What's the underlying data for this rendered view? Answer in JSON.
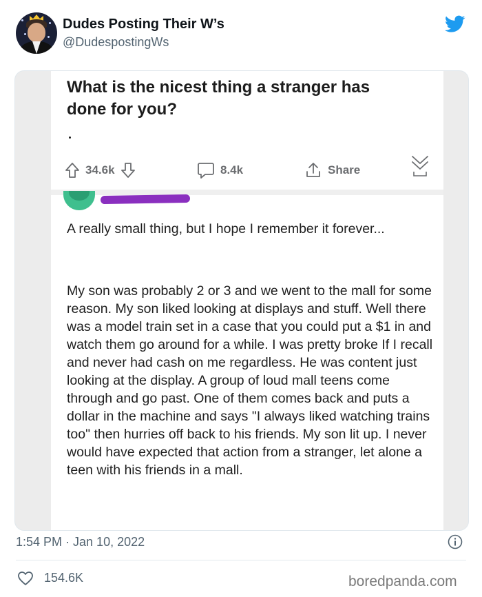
{
  "author": {
    "display_name": "Dudes Posting Their W’s",
    "handle": "@DudespostingWs"
  },
  "embedded_post": {
    "question": "What is the nicest thing a stranger has done for you?",
    "upvotes": "34.6k",
    "comments": "8.4k",
    "share_label": "Share",
    "lead": "A really small thing, but I hope I remember it forever...",
    "body": "My son was probably 2 or 3 and we went to the mall for some reason. My son liked looking at displays and stuff. Well there was a model train set in a case that you could put a $1 in and watch them go around for a while. I was pretty broke If I recall and never had cash on me regardless. He was content just looking at the display. A group of loud mall teens come through and go past. One of them comes back and puts a dollar in the machine and says \"I always liked watching trains too\" then hurries off back to his friends. My son lit up. I never would have expected that action from a stranger, let alone a teen with his friends in a mall."
  },
  "tweet_meta": {
    "timestamp": "1:54 PM · Jan 10, 2022",
    "likes": "154.6K"
  },
  "watermark": "boredpanda.com",
  "colors": {
    "twitter_blue": "#1d9bf0",
    "secondary_text": "#536471",
    "redaction": "#8a2fbf"
  },
  "icons": [
    "twitter-bird-icon",
    "upvote-arrow-icon",
    "downvote-arrow-icon",
    "comment-icon",
    "share-icon",
    "collapse-chevron-icon",
    "info-icon",
    "heart-icon"
  ]
}
